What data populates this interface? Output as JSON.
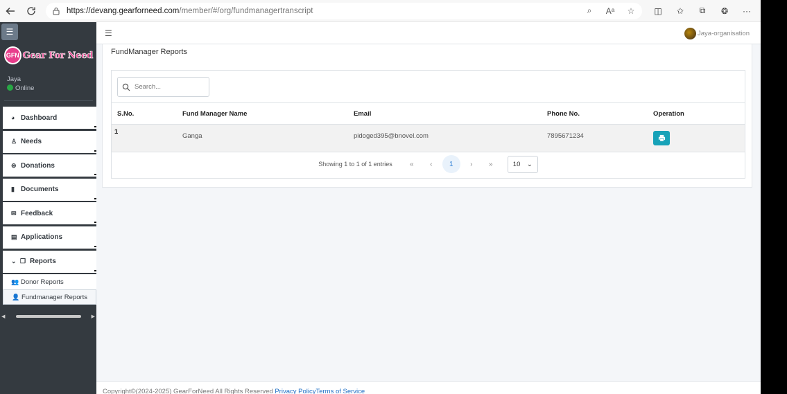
{
  "browser": {
    "url_host": "https://devang.gearforneed.com",
    "url_path": "/member/#/org/fundmanagertranscript"
  },
  "sidebar": {
    "brand": "Gear For Need",
    "brand_mark": "GFN",
    "user_name": "Jaya",
    "status": "Online",
    "menu": [
      {
        "label": "Dashboard",
        "icon": "chart-pie-icon",
        "glyph": "◕"
      },
      {
        "label": "Needs",
        "icon": "hand-holding-icon",
        "glyph": "♙"
      },
      {
        "label": "Donations",
        "icon": "donation-icon",
        "glyph": "⊜"
      },
      {
        "label": "Documents",
        "icon": "file-icon",
        "glyph": "▮"
      },
      {
        "label": "Feedback",
        "icon": "envelope-icon",
        "glyph": "✉"
      },
      {
        "label": "Applications",
        "icon": "file-alt-icon",
        "glyph": "▤"
      },
      {
        "label": "Reports",
        "icon": "copy-icon",
        "glyph": "❐"
      }
    ],
    "submenu": [
      {
        "label": "Donor Reports",
        "icon": "users-icon",
        "glyph": "👥"
      },
      {
        "label": "Fundmanager Reports",
        "icon": "user-icon",
        "glyph": "👤"
      }
    ]
  },
  "header": {
    "org_name": "Jaya-organisation"
  },
  "page": {
    "title": "FundManager Reports",
    "search_placeholder": "Search...",
    "columns": [
      "S.No.",
      "Fund Manager Name",
      "Email",
      "Phone No.",
      "Operation"
    ],
    "rows": [
      {
        "sno": "1",
        "name": "Ganga",
        "email": "pidoged395@bnovel.com",
        "phone": "7895671234"
      }
    ],
    "pagination": {
      "info": "Showing 1 to 1 of 1 entries",
      "first": "«",
      "prev": "‹",
      "current": "1",
      "next": "›",
      "last": "»",
      "page_size": "10"
    }
  },
  "footer": {
    "copyright": "Copyright©(2024-2025) GearForNeed All Rights Reserved ",
    "privacy": "Privacy Policy",
    "terms": "Terms of Service"
  },
  "colors": {
    "sidebar_bg": "#343a40",
    "brand": "#e83e8c",
    "online": "#28a745",
    "print_button": "#17a2b8",
    "link": "#1f6fc5"
  }
}
